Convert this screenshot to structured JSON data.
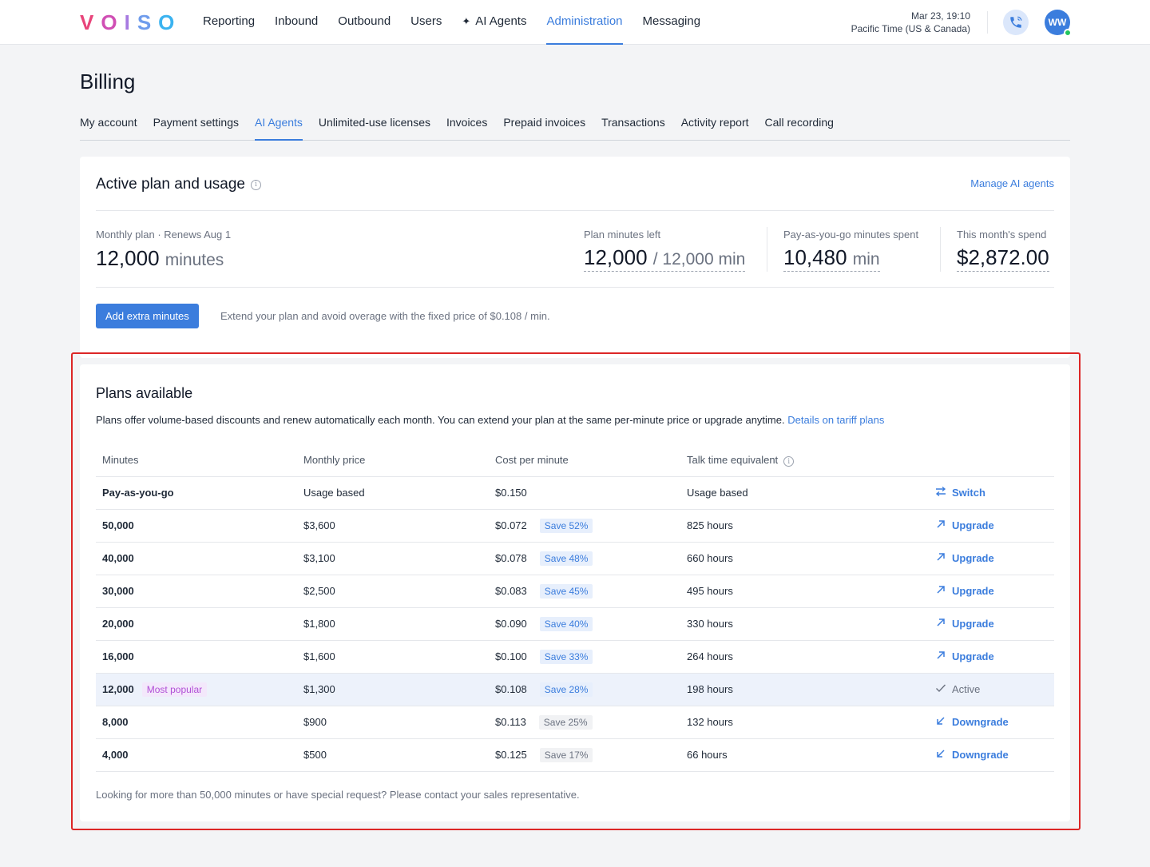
{
  "brand": {
    "letters": [
      "V",
      "O",
      "I",
      "S",
      "O"
    ],
    "colors": [
      "#e8447a",
      "#d04fb4",
      "#a77ae0",
      "#6f9cec",
      "#3bb3f0"
    ]
  },
  "nav": {
    "items": [
      {
        "label": "Reporting",
        "active": false
      },
      {
        "label": "Inbound",
        "active": false
      },
      {
        "label": "Outbound",
        "active": false
      },
      {
        "label": "Users",
        "active": false
      },
      {
        "label": "AI Agents",
        "active": false,
        "icon": "sparkle-icon"
      },
      {
        "label": "Administration",
        "active": true
      },
      {
        "label": "Messaging",
        "active": false
      }
    ],
    "datetime": "Mar 23, 19:10",
    "timezone": "Pacific Time (US & Canada)",
    "avatar_initials": "WW"
  },
  "page": {
    "title": "Billing",
    "tabs": [
      {
        "label": "My account",
        "active": false
      },
      {
        "label": "Payment settings",
        "active": false
      },
      {
        "label": "AI Agents",
        "active": true
      },
      {
        "label": "Unlimited-use licenses",
        "active": false
      },
      {
        "label": "Invoices",
        "active": false
      },
      {
        "label": "Prepaid invoices",
        "active": false
      },
      {
        "label": "Transactions",
        "active": false
      },
      {
        "label": "Activity report",
        "active": false
      },
      {
        "label": "Call recording",
        "active": false
      }
    ]
  },
  "active_plan": {
    "title": "Active plan and usage",
    "manage_link": "Manage AI agents",
    "monthly": {
      "label": "Monthly plan · Renews Aug 1",
      "value": "12,000",
      "unit": "minutes"
    },
    "minutes_left": {
      "label": "Plan minutes left",
      "value": "12,000",
      "unit": "/ 12,000 min"
    },
    "payg_spent": {
      "label": "Pay-as-you-go minutes spent",
      "value": "10,480",
      "unit": "min"
    },
    "spend": {
      "label": "This month's spend",
      "value": "$2,872.00"
    },
    "add_button": "Add extra minutes",
    "hint": "Extend your plan and avoid overage with the fixed price of $0.108 / min."
  },
  "plans": {
    "title": "Plans available",
    "description": "Plans offer volume-based discounts and renew automatically each month. You can extend your plan at the same per-minute price or upgrade anytime.",
    "details_link": "Details on tariff plans",
    "columns": [
      "Minutes",
      "Monthly price",
      "Cost per minute",
      "Talk time equivalent"
    ],
    "rows": [
      {
        "minutes": "Pay-as-you-go",
        "price": "Usage based",
        "cost": "$0.150",
        "save": "",
        "talk": "Usage based",
        "action": "Switch",
        "action_icon": "switch-icon",
        "kind": "link"
      },
      {
        "minutes": "50,000",
        "price": "$3,600",
        "cost": "$0.072",
        "save": "Save 52%",
        "talk": "825 hours",
        "action": "Upgrade",
        "action_icon": "arrow-up-right-icon",
        "kind": "link"
      },
      {
        "minutes": "40,000",
        "price": "$3,100",
        "cost": "$0.078",
        "save": "Save 48%",
        "talk": "660 hours",
        "action": "Upgrade",
        "action_icon": "arrow-up-right-icon",
        "kind": "link"
      },
      {
        "minutes": "30,000",
        "price": "$2,500",
        "cost": "$0.083",
        "save": "Save 45%",
        "talk": "495 hours",
        "action": "Upgrade",
        "action_icon": "arrow-up-right-icon",
        "kind": "link"
      },
      {
        "minutes": "20,000",
        "price": "$1,800",
        "cost": "$0.090",
        "save": "Save 40%",
        "talk": "330 hours",
        "action": "Upgrade",
        "action_icon": "arrow-up-right-icon",
        "kind": "link"
      },
      {
        "minutes": "16,000",
        "price": "$1,600",
        "cost": "$0.100",
        "save": "Save 33%",
        "talk": "264 hours",
        "action": "Upgrade",
        "action_icon": "arrow-up-right-icon",
        "kind": "link"
      },
      {
        "minutes": "12,000",
        "badge": "Most popular",
        "price": "$1,300",
        "cost": "$0.108",
        "save": "Save 28%",
        "talk": "198 hours",
        "action": "Active",
        "action_icon": "check-icon",
        "kind": "active"
      },
      {
        "minutes": "8,000",
        "price": "$900",
        "cost": "$0.113",
        "save": "Save 25%",
        "save_muted": true,
        "talk": "132 hours",
        "action": "Downgrade",
        "action_icon": "arrow-down-left-icon",
        "kind": "link"
      },
      {
        "minutes": "4,000",
        "price": "$500",
        "cost": "$0.125",
        "save": "Save 17%",
        "save_muted": true,
        "talk": "66 hours",
        "action": "Downgrade",
        "action_icon": "arrow-down-left-icon",
        "kind": "link"
      }
    ],
    "footnote": "Looking for more than 50,000 minutes or have special request? Please contact your sales representative."
  }
}
